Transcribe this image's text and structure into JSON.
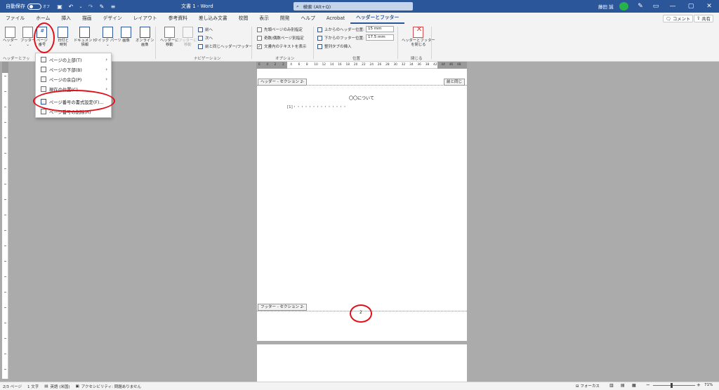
{
  "titlebar": {
    "autosave_label": "自動保存",
    "autosave_state": "オフ",
    "doc_title": "文書 1 - Word",
    "search_placeholder": "検索 (Alt+Q)",
    "user_name": "藤田 誠"
  },
  "tabs": [
    "ファイル",
    "ホーム",
    "挿入",
    "描画",
    "デザイン",
    "レイアウト",
    "参考資料",
    "差し込み文書",
    "校閲",
    "表示",
    "開発",
    "ヘルプ",
    "Acrobat",
    "ヘッダーとフッター"
  ],
  "header_buttons": {
    "comment": "コメント",
    "share": "共有"
  },
  "ribbon": {
    "header_btn": "ヘッダー",
    "footer_btn": "フッター",
    "page_number_btn": [
      "ページ",
      "番号"
    ],
    "datetime_btn": [
      "日付と",
      "時刻"
    ],
    "docinfo_btn": [
      "ドキュメント",
      "情報"
    ],
    "quickparts_btn": "クイック パーツ",
    "picture_btn": "画像",
    "online_picture_btn": [
      "オンライン",
      "画像"
    ],
    "goto_header_btn": [
      "ヘッダーに",
      "移動"
    ],
    "goto_footer_btn": [
      "フッターに",
      "移動"
    ],
    "prev_btn": "前へ",
    "next_btn": "次へ",
    "link_prev_btn": "前と同じヘッダー/フッター",
    "opt_first_page": "先頭ページのみ別指定",
    "opt_odd_even": "奇数/偶数ページ別指定",
    "opt_show_text": "文書内のテキストを表示",
    "header_pos_label": "上からのヘッダー位置:",
    "header_pos_value": "15 mm",
    "footer_pos_label": "下からのフッター位置:",
    "footer_pos_value": "17.5 mm",
    "insert_tab_align": "整列タブの挿入",
    "close_btn": [
      "ヘッダーとフッター",
      "を閉じる"
    ],
    "group_hf": "ヘッダーとフッ",
    "group_nav": "ナビゲーション",
    "group_options": "オプション",
    "group_position": "位置",
    "group_close": "閉じる"
  },
  "dropdown": {
    "items": [
      {
        "label": "ページの上部(T)",
        "submenu": true
      },
      {
        "label": "ページの下部(B)",
        "submenu": true
      },
      {
        "label": "ページの余白(P)",
        "submenu": true
      },
      {
        "label": "現在の位置(C)",
        "submenu": true
      },
      {
        "label": "ページ番号の書式設定(F)...",
        "submenu": false
      },
      {
        "label": "ページ番号の削除(R)",
        "submenu": false
      }
    ]
  },
  "ruler": {
    "top_labels": [
      "6",
      "4",
      "2",
      "2",
      "4",
      "6",
      "8",
      "10",
      "12",
      "14",
      "16",
      "18",
      "20",
      "22",
      "24",
      "26",
      "28",
      "30",
      "32",
      "34",
      "36",
      "38",
      "42",
      "44",
      "46",
      "48"
    ]
  },
  "document": {
    "header_label": "ヘッダー - セクション 2-",
    "same_as_prev": "前と同じ",
    "body_title": "〇〇について",
    "toc_line": "[1]・・・・・・・・・・・・・・",
    "footer_label": "フッター - セクション 2-",
    "footer_page_number": "2"
  },
  "status": {
    "page": "2/3 ページ",
    "words": "1 文字",
    "lang": "英語 (米国)",
    "accessibility": "アクセシビリティ: 問題ありません",
    "focus": "フォーカス",
    "zoom": "71%"
  },
  "colors": {
    "accent": "#2b579a",
    "highlight_circle": "#e0101a"
  }
}
